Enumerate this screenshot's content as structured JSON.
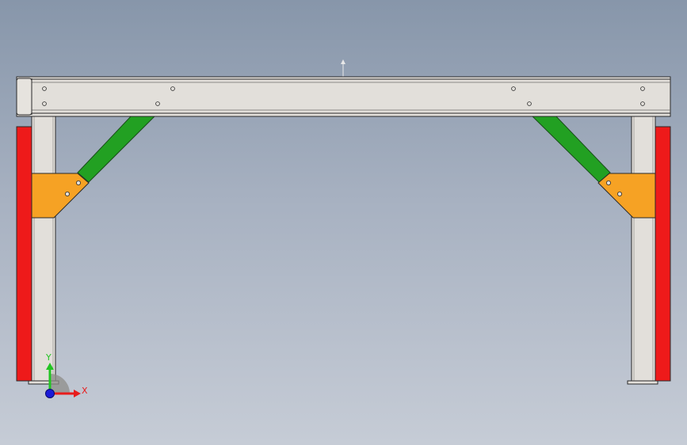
{
  "viewport": {
    "background_top": "#8796aa",
    "background_bottom": "#c6ccd6"
  },
  "model": {
    "frame_color": "#e2dfda",
    "outline_color": "#2a2a2a",
    "pad_color": "#ee1a1a",
    "brace_color": "#22a022",
    "gusset_color": "#f6a224"
  },
  "triad": {
    "x_label": "X",
    "y_label": "Y",
    "x_color": "#e81c1c",
    "y_color": "#22c422",
    "z_color": "#1a1ad8"
  }
}
